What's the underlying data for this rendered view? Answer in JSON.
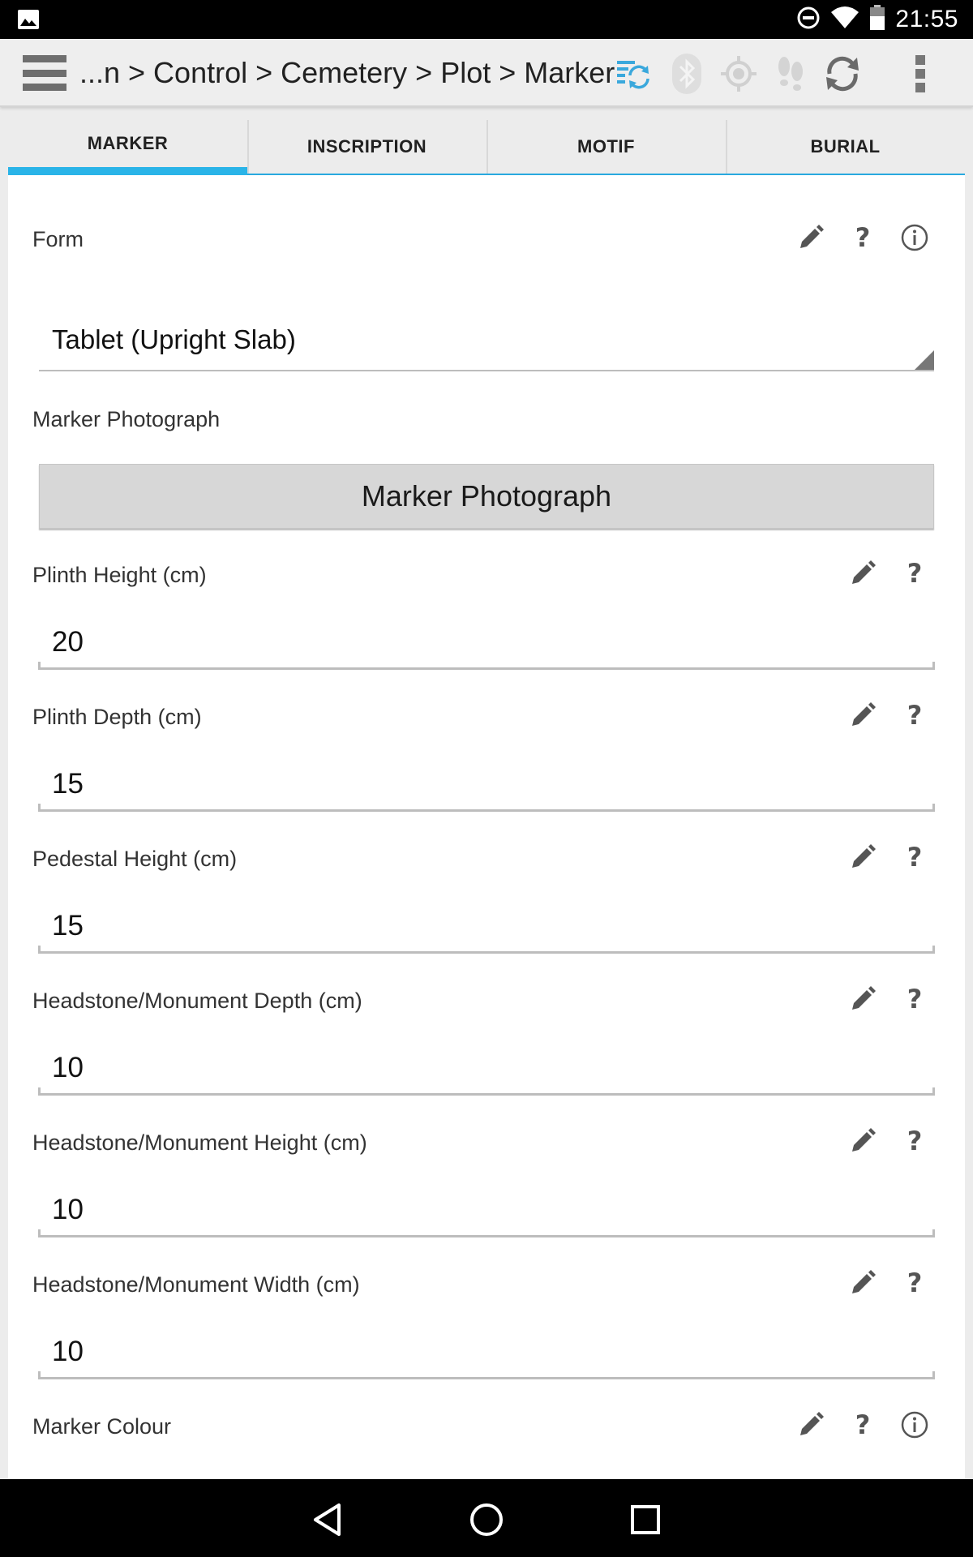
{
  "status_bar": {
    "time": "21:55",
    "icons": [
      "image-icon",
      "do-not-disturb-icon",
      "wifi-icon",
      "battery-icon"
    ]
  },
  "toolbar": {
    "breadcrumb": "...n > Control > Cemetery > Plot > Marker",
    "icons": [
      "menu-icon",
      "sync-status-icon",
      "bluetooth-icon",
      "gps-icon",
      "tracker-icon",
      "refresh-icon",
      "overflow-menu-icon"
    ]
  },
  "tabs": [
    {
      "label": "MARKER",
      "active": true
    },
    {
      "label": "INSCRIPTION",
      "active": false
    },
    {
      "label": "MOTIF",
      "active": false
    },
    {
      "label": "BURIAL",
      "active": false
    }
  ],
  "form": {
    "form_field": {
      "label": "Form",
      "value": "Tablet (Upright Slab)"
    },
    "photo_field": {
      "label": "Marker Photograph",
      "button_label": "Marker Photograph"
    },
    "fields": [
      {
        "label": "Plinth Height (cm)",
        "value": "20"
      },
      {
        "label": "Plinth Depth (cm)",
        "value": "15"
      },
      {
        "label": "Pedestal Height (cm)",
        "value": "15"
      },
      {
        "label": "Headstone/Monument Depth (cm)",
        "value": "10"
      },
      {
        "label": "Headstone/Monument Height (cm)",
        "value": "10"
      },
      {
        "label": "Headstone/Monument Width (cm)",
        "value": "10"
      }
    ],
    "colour_field": {
      "label": "Marker Colour"
    },
    "help_glyph": "?"
  },
  "colors": {
    "accent": "#2ab4e8",
    "icon_gray": "#555555",
    "disabled_icon": "#cfcfcf"
  }
}
